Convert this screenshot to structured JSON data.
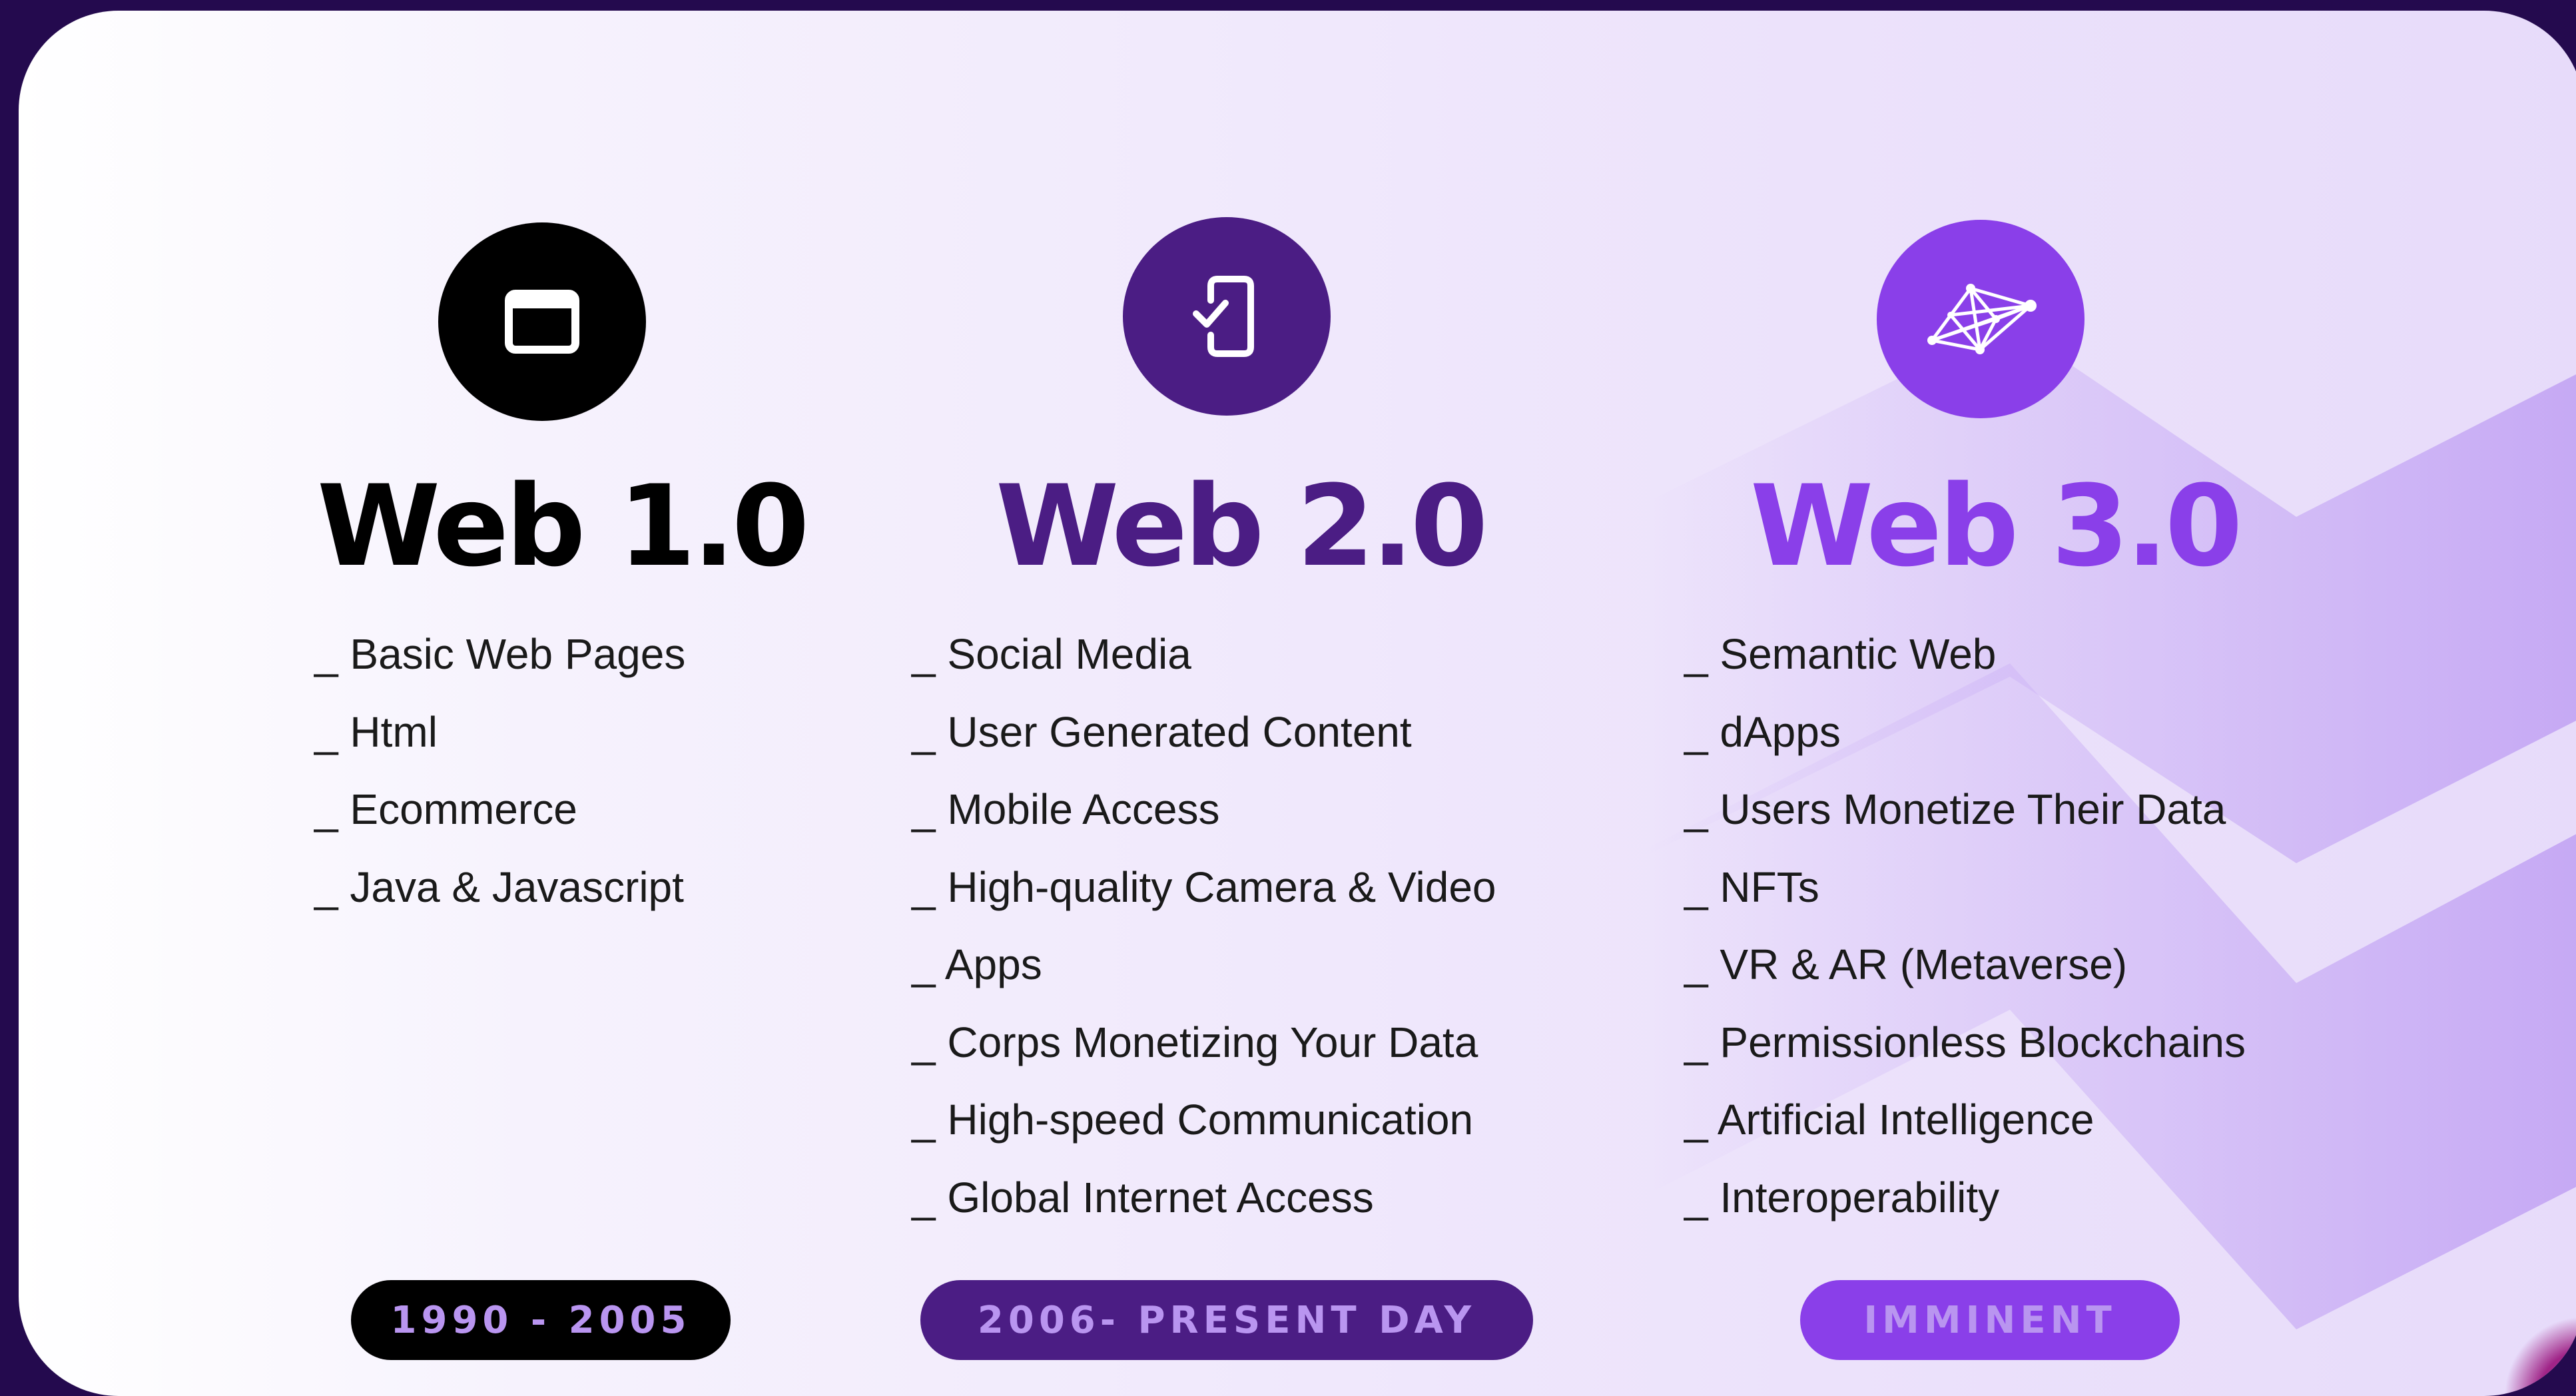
{
  "colors": {
    "background": "#240a4e",
    "web1": "#000000",
    "web2": "#4b1d84",
    "web3": "#8a3fe9",
    "badge_text": "#b995f0"
  },
  "columns": [
    {
      "icon": "browser-window-icon",
      "title": "Web 1.0",
      "features": [
        "_ Basic Web Pages",
        "_ Html",
        "_ Ecommerce",
        "_ Java & Javascript"
      ],
      "period": "1990 - 2005"
    },
    {
      "icon": "mobile-check-icon",
      "title": "Web 2.0",
      "features": [
        "_ Social Media",
        "_ User Generated Content",
        "_ Mobile Access",
        "_ High-quality Camera & Video",
        "_ Apps",
        "_ Corps Monetizing Your Data",
        "_ High-speed Communication",
        "_ Global Internet Access"
      ],
      "period": "2006- PRESENT DAY"
    },
    {
      "icon": "network-mesh-icon",
      "title": "Web 3.0",
      "features": [
        "_ Semantic Web",
        "_ dApps",
        "_ Users Monetize Their Data",
        "_ NFTs",
        "_ VR & AR (Metaverse)",
        "_ Permissionless Blockchains",
        "_ Artificial Intelligence",
        "_ Interoperability"
      ],
      "period": "IMMINENT"
    }
  ]
}
